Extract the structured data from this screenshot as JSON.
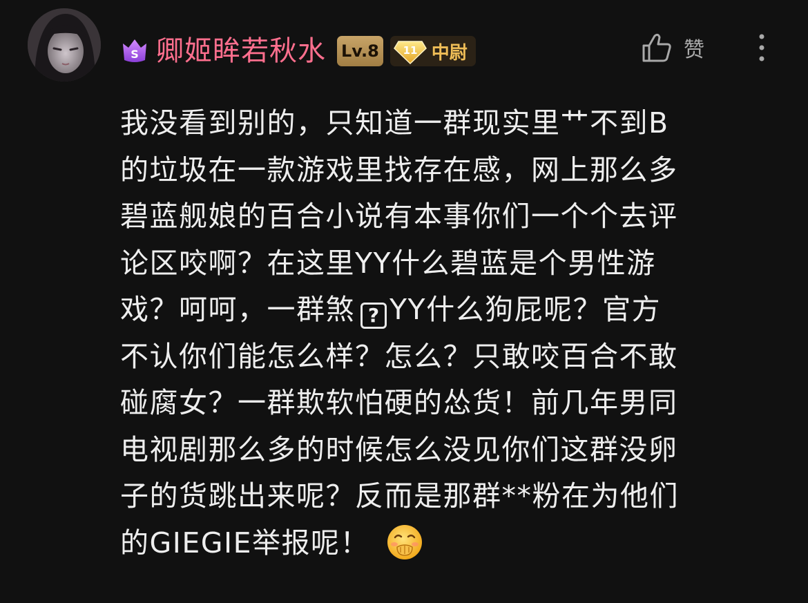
{
  "comment": {
    "user": {
      "name": "卿姬眸若秋水",
      "level": "Lv.8",
      "fan_medal": {
        "level": "11",
        "title": "中尉"
      },
      "vip_icon": "vip-s-crown-icon",
      "name_color": "#ff6f8e"
    },
    "like_label": "赞",
    "icons": {
      "like": "thumbs-up-icon",
      "more": "more-vertical-icon",
      "emoji": "covering-mouth-laugh-emoji"
    },
    "content_lines": [
      "我没看到别的，只知道一群现实里艹不到B",
      "的垃圾在一款游戏里找存在感，网上那么多",
      "碧蓝舰娘的百合小说有本事你们一个个去评",
      "论区咬啊？在这里YY什么碧蓝是个男性游",
      "戏？呵呵，一群煞",
      "YY什么狗屁呢？官方",
      "不认你们能怎么样？怎么？只敢咬百合不敢",
      "碰腐女？一群欺软怕硬的怂货！前几年男同",
      "电视剧那么多的时候怎么没见你们这群没卵",
      "子的货跳出来呢？反而是那群**粉在为他们",
      "的GIEGIE举报呢！"
    ],
    "missing_glyph": "?"
  }
}
